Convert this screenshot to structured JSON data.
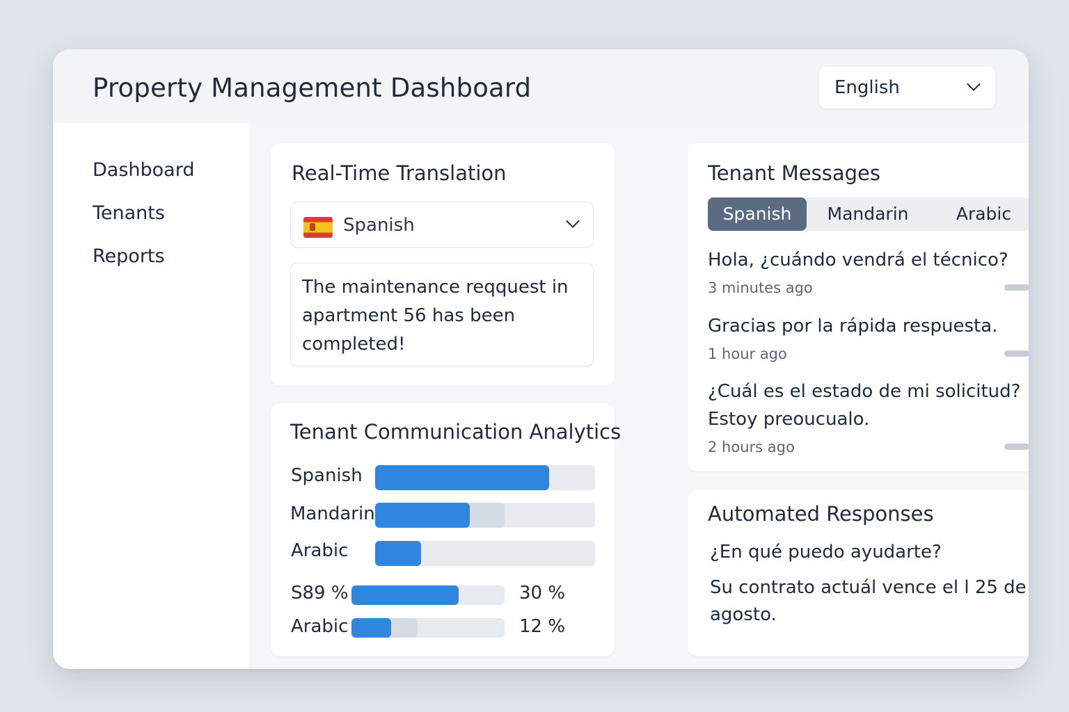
{
  "header": {
    "title": "Property Management Dashboard",
    "language_select": "English"
  },
  "sidebar": {
    "items": [
      {
        "label": "Dashboard"
      },
      {
        "label": "Tenants"
      },
      {
        "label": "Reports"
      }
    ]
  },
  "translation": {
    "title": "Real-Time Translation",
    "selected_language": "Spanish",
    "flag_icon": "spain-flag-icon",
    "output_text": "The maintenance reqquest in apartment 56 has been completed!"
  },
  "analytics": {
    "title": "Tenant Communication Analytics",
    "bars": [
      {
        "label": "Spanish",
        "fraction": 0.79
      },
      {
        "label": "Mandarin",
        "fraction": 0.43,
        "secondary_fraction": 0.59
      },
      {
        "label": "Arabic",
        "fraction": 0.21
      }
    ],
    "rows": [
      {
        "label": "S89 %",
        "fraction": 0.7,
        "percent": "30 %"
      },
      {
        "label": "Arabic",
        "fraction": 0.26,
        "secondary_fraction": 0.43,
        "percent": "12 %"
      }
    ],
    "colors": {
      "fill": "#2f86de",
      "track": "#e7eaef",
      "ghost": "#d6dce4"
    }
  },
  "messages": {
    "title": "Tenant Messages",
    "tabs": [
      {
        "label": "Spanish",
        "active": true
      },
      {
        "label": "Mandarin",
        "active": false
      },
      {
        "label": "Arabic",
        "active": false
      }
    ],
    "items": [
      {
        "text": "Hola, ¿cuándo vendrá el técnico?",
        "time": "3 minutes ago"
      },
      {
        "text": "Gracias por la rápida respuesta.",
        "time": "1 hour ago"
      },
      {
        "text": "¿Cuál es el estado de mi solicitud? Estoy preoucualo.",
        "time": "2 hours ago"
      }
    ]
  },
  "automated": {
    "title": "Automated Responses",
    "responses": [
      "¿En qué puedo ayudarte?",
      "Su contrato actuál vence el l 25 de agosto."
    ]
  }
}
